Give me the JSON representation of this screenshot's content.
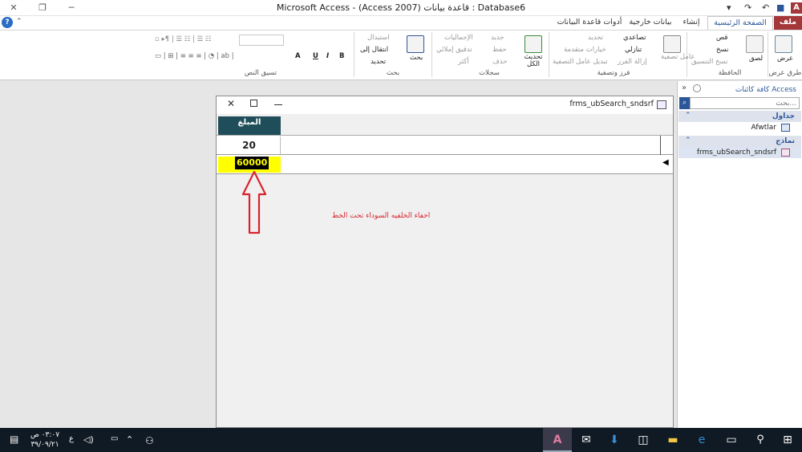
{
  "window": {
    "title": "Microsoft Access - (Access 2007) قاعدة بيانات : Database6",
    "close_glyph": "✕",
    "restore_glyph": "❐",
    "minimize_glyph": "─",
    "smiley": "☺"
  },
  "qat": {
    "items": [
      "A",
      "■",
      "↶",
      "↷",
      "▾"
    ]
  },
  "tabs": {
    "file": "ملف",
    "home": "الصفحة الرئيسية",
    "create": "إنشاء",
    "external": "بيانات خارجية",
    "dbtools": "أدوات قاعدة البيانات"
  },
  "ribbon": {
    "views": {
      "view": "عرض",
      "group": "طرق عرض"
    },
    "clipboard": {
      "paste": "لصق",
      "cut": "قص",
      "copy": "نسخ",
      "format_painter": "نسخ التنسيق",
      "group": "الحافظة"
    },
    "sort": {
      "filter": "عامل تصفية",
      "ascending": "تصاعدي",
      "descending": "تنازلي",
      "remove_sort": "إزالة الفرز",
      "selection": "تحديد",
      "advanced": "خيارات متقدمة",
      "toggle_filter": "تبديل عامل التصفية",
      "group": "فرز وتصفية"
    },
    "records": {
      "refresh": "تحديث الكل",
      "new": "جديد",
      "save": "حفظ",
      "delete": "حذف",
      "totals": "الإجماليات",
      "spelling": "تدقيق إملائي",
      "more": "أكثر",
      "group": "سجلات"
    },
    "find": {
      "find": "بحث",
      "replace": "استبدال",
      "goto": "انتقال إلى",
      "select": "تحديد",
      "group": "بحث"
    },
    "text": {
      "group": "تسيق النص",
      "bold": "B",
      "italic": "I",
      "underline": "U",
      "fontcolor": "A"
    }
  },
  "navpane": {
    "title": "كافة كائنات Access",
    "search_placeholder": "بحث...",
    "tables_label": "جداول",
    "table_item": "Afwtlar",
    "forms_label": "نماذج",
    "form_item": "frms_ubSearch_sndsrf"
  },
  "form": {
    "title": "frms_ubSearch_sndsrf",
    "column_header": "المبلغ",
    "row1_value": "20",
    "row2_value": "60000",
    "annotation": "اخفاء الخلفيه السوداء تحت الخط",
    "accent_color": "#d9232e",
    "header_color": "#1f4e5a",
    "highlight_color": "#ffff00"
  },
  "taskbar": {
    "time": "٠٣:٠٧ ص",
    "date": "٣٩/٠٩/٢١",
    "lang": "ع"
  }
}
